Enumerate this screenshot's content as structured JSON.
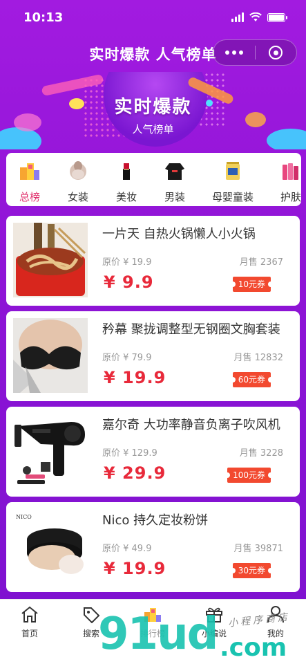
{
  "status_bar": {
    "time": "10:13"
  },
  "navbar": {
    "title": "实时爆款 人气榜单"
  },
  "banner": {
    "title": "实时爆款",
    "subtitle": "人气榜单"
  },
  "categories": [
    {
      "label": "总榜",
      "icon": "ranking-blocks-icon",
      "active": true
    },
    {
      "label": "女装",
      "icon": "women-clothing-icon"
    },
    {
      "label": "美妆",
      "icon": "lipstick-icon"
    },
    {
      "label": "男装",
      "icon": "men-hoodie-icon"
    },
    {
      "label": "母婴童装",
      "icon": "milk-powder-icon"
    },
    {
      "label": "护肤",
      "icon": "skincare-bottles-icon"
    }
  ],
  "products": [
    {
      "title": "一片天 自热火锅懒人小火锅",
      "orig_price": "原价 ¥ 19.9",
      "sales": "月售 2367",
      "price": "¥ 9.9",
      "coupon": "10元券"
    },
    {
      "title": "矜幕 聚拢调整型无钢圈文胸套装",
      "orig_price": "原价 ¥ 79.9",
      "sales": "月售 12832",
      "price": "¥ 19.9",
      "coupon": "60元券"
    },
    {
      "title": "嘉尔奇 大功率静音负离子吹风机",
      "orig_price": "原价 ¥ 129.9",
      "sales": "月售 3228",
      "price": "¥ 29.9",
      "coupon": "100元券"
    },
    {
      "title": "Nico 持久定妆粉饼",
      "orig_price": "原价 ¥ 49.9",
      "sales": "月售 39871",
      "price": "¥ 19.9",
      "coupon": "30元券",
      "thumb_brand": "NICO"
    }
  ],
  "tabbar": [
    {
      "label": "首页",
      "icon": "home-icon"
    },
    {
      "label": "搜索",
      "icon": "tag-search-icon"
    },
    {
      "label": "排行榜",
      "icon": "ranking-icon",
      "active": true
    },
    {
      "label": "小编说",
      "icon": "gift-icon"
    },
    {
      "label": "我的",
      "icon": "person-icon"
    }
  ],
  "watermark": {
    "text": "91ud",
    "domain": ".com",
    "caption": "小程序商店"
  }
}
